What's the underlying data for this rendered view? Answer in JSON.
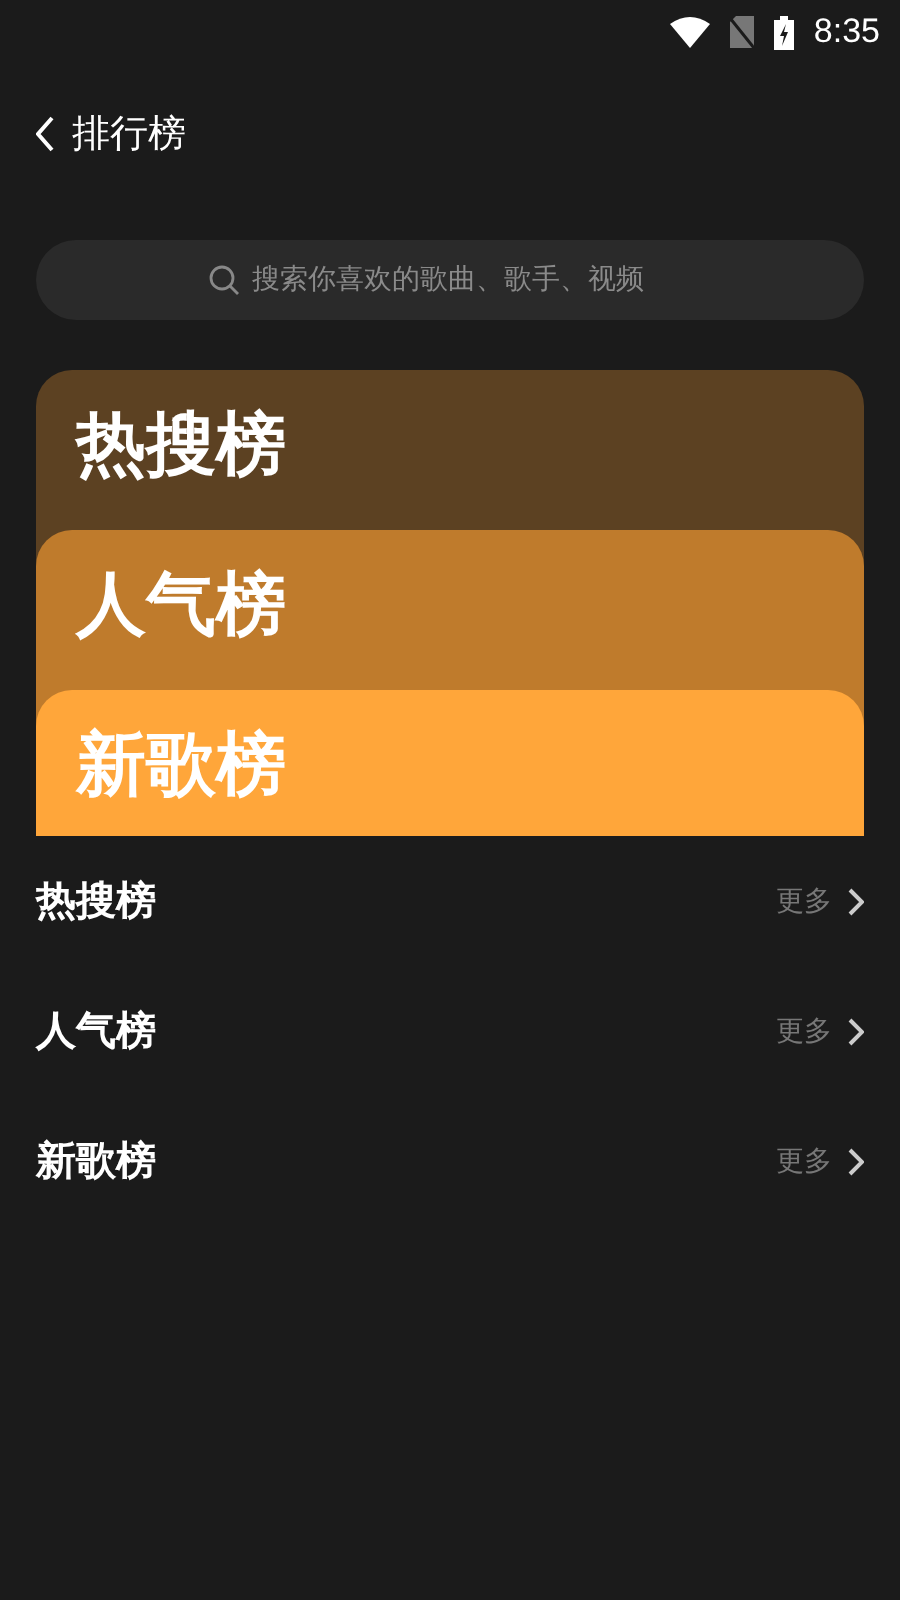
{
  "status_bar": {
    "time": "8:35"
  },
  "header": {
    "title": "排行榜"
  },
  "search": {
    "placeholder": "搜索你喜欢的歌曲、歌手、视频"
  },
  "cards": [
    {
      "title": "热搜榜",
      "color": "#5c4122"
    },
    {
      "title": "人气榜",
      "color": "#bf7b2c"
    },
    {
      "title": "新歌榜",
      "color": "#ffa63a"
    }
  ],
  "sections": [
    {
      "title": "热搜榜",
      "more": "更多"
    },
    {
      "title": "人气榜",
      "more": "更多"
    },
    {
      "title": "新歌榜",
      "more": "更多"
    }
  ]
}
